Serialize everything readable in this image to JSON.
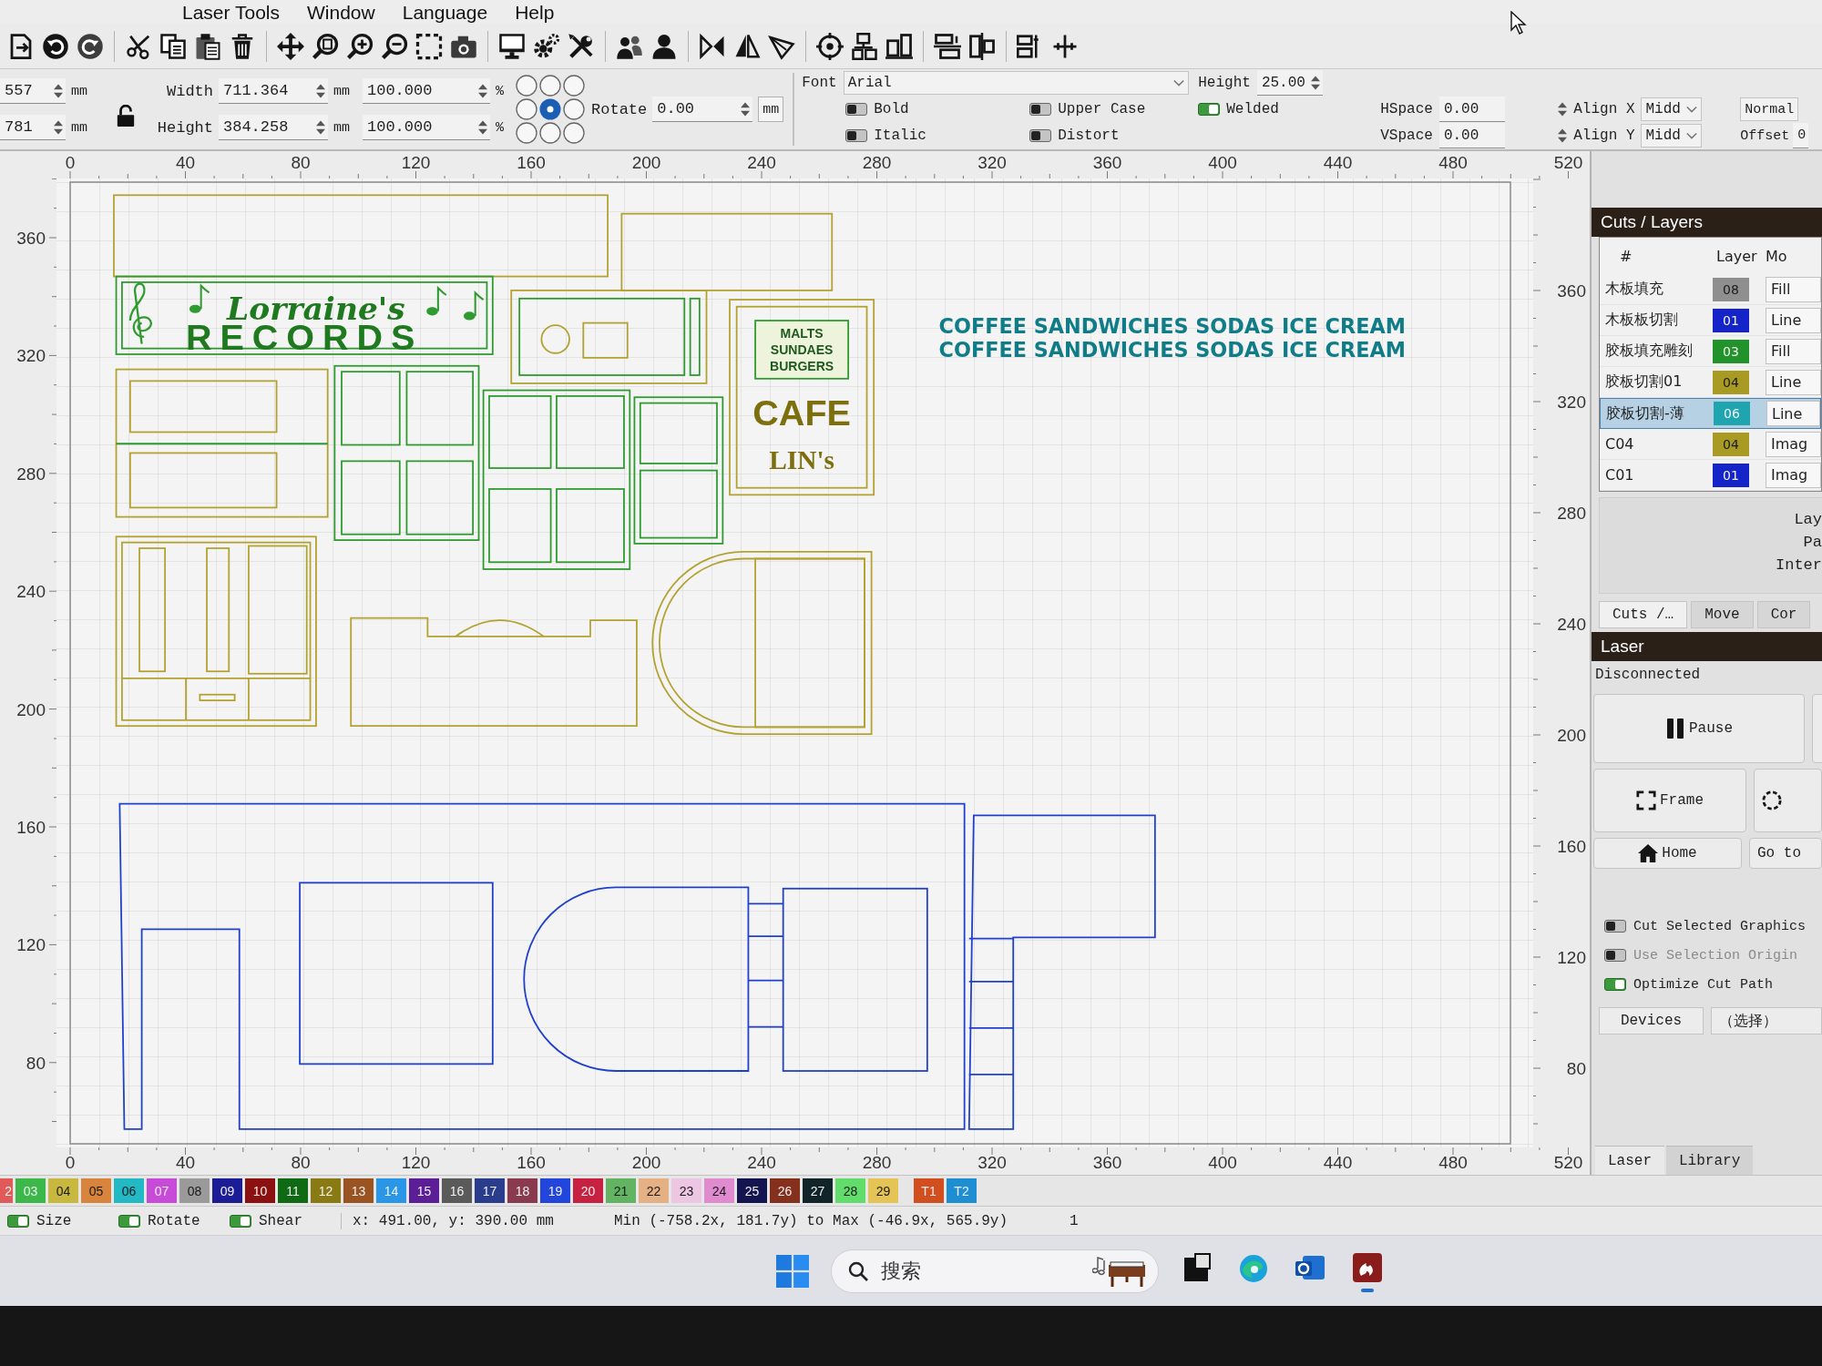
{
  "menu_bar": {
    "items": [
      "Laser Tools",
      "Window",
      "Language",
      "Help"
    ]
  },
  "position": {
    "x": {
      "value": "557",
      "unit": "mm"
    },
    "y": {
      "value": "781",
      "unit": "mm"
    }
  },
  "size_lock": {
    "locked": false
  },
  "size": [
    {
      "label": "Width",
      "value": "711.364",
      "unit": "mm",
      "scale": "100.000",
      "scale_unit": "%"
    },
    {
      "label": "Height",
      "value": "384.258",
      "unit": "mm",
      "scale": "100.000",
      "scale_unit": "%"
    }
  ],
  "origin_points": [
    {
      "selected": false
    },
    {
      "selected": false
    },
    {
      "selected": false
    },
    {
      "selected": false
    },
    {
      "selected": true
    },
    {
      "selected": false
    },
    {
      "selected": false
    },
    {
      "selected": false
    },
    {
      "selected": false
    }
  ],
  "rotate": {
    "label": "Rotate",
    "value": "0.00",
    "unit_button": "mm"
  },
  "text_options": {
    "font": {
      "label": "Font",
      "value": "Arial"
    },
    "toggles": [
      {
        "label": "Bold",
        "on": false
      },
      {
        "label": "Italic",
        "on": false
      },
      {
        "label": "Upper Case",
        "on": false
      },
      {
        "label": "Distort",
        "on": false
      },
      {
        "label": "Welded",
        "on": true
      }
    ],
    "height": {
      "label": "Height",
      "value": "25.00"
    },
    "hspace": {
      "label": "HSpace",
      "value": "0.00"
    },
    "vspace": {
      "label": "VSpace",
      "value": "0.00"
    },
    "align_x": {
      "label": "Align X",
      "value": "Midd"
    },
    "align_y": {
      "label": "Align Y",
      "value": "Midd"
    },
    "style": "Normal",
    "offset": {
      "label": "Offset",
      "value": "0"
    }
  },
  "canvas": {
    "top_ruler": [
      "0",
      "40",
      "80",
      "120",
      "160",
      "200",
      "240",
      "280",
      "320",
      "360",
      "400",
      "440",
      "480",
      "520"
    ],
    "left_ruler": [
      "360",
      "320",
      "280",
      "240",
      "200",
      "160",
      "120",
      "80"
    ],
    "right_ruler": [
      "360",
      "320",
      "280",
      "240",
      "200",
      "160",
      "120",
      "80"
    ],
    "bottom_ruler": [
      "0",
      "40",
      "80",
      "120",
      "160",
      "200",
      "240",
      "280",
      "320",
      "360",
      "400",
      "440",
      "480",
      "520"
    ],
    "texts": [
      {
        "kind": "script",
        "text": "Lorraine's"
      },
      {
        "kind": "outline",
        "text": "RECORDS"
      },
      {
        "kind": "block",
        "text": "MALTS"
      },
      {
        "kind": "block",
        "text": "SUNDAES"
      },
      {
        "kind": "block",
        "text": "BURGERS"
      },
      {
        "kind": "outline",
        "text": "CAFE"
      },
      {
        "kind": "serif",
        "text": "LIN's"
      },
      {
        "kind": "banner",
        "text": "COFFEE SANDWICHES SODAS ICE CREAM"
      },
      {
        "kind": "banner",
        "text": "COFFEE SANDWICHES SODAS ICE CREAM"
      }
    ]
  },
  "cuts_layers": {
    "title": "Cuts / Layers",
    "columns": [
      "#",
      "Layer",
      "Mo"
    ],
    "rows": [
      {
        "name": "木板填充",
        "number": "08",
        "color": "#8f8f8f",
        "mode": "Fill",
        "selected": false
      },
      {
        "name": "木板板切割",
        "number": "01",
        "color": "#1424c8",
        "mode": "Line",
        "selected": false
      },
      {
        "name": "胶板填充雕刻",
        "number": "03",
        "color": "#22922a",
        "mode": "Fill",
        "selected": false
      },
      {
        "name": "胶板切割01",
        "number": "04",
        "color": "#a89a22",
        "mode": "Line",
        "selected": false
      },
      {
        "name": "胶板切割-薄",
        "number": "06",
        "color": "#1ea5b0",
        "mode": "Line",
        "selected": true
      },
      {
        "name": "C04",
        "number": "04",
        "color": "#a89a22",
        "mode": "Imag",
        "selected": false
      },
      {
        "name": "C01",
        "number": "01",
        "color": "#1424c8",
        "mode": "Imag",
        "selected": false
      }
    ],
    "details": [
      "Lay",
      "Pa",
      "Inter"
    ]
  },
  "panel_tabs": [
    {
      "label": "Cuts /…",
      "selected": true
    },
    {
      "label": "Move",
      "selected": false
    },
    {
      "label": "Cor",
      "selected": false
    }
  ],
  "laser": {
    "title": "Laser",
    "status": "Disconnected",
    "buttons": [
      {
        "kind": "pause",
        "label": "Pause"
      },
      {
        "kind": "blank"
      },
      {
        "kind": "frame",
        "label": "Frame"
      },
      {
        "kind": "dashed_circle"
      },
      {
        "kind": "home",
        "label": "Home"
      },
      {
        "kind": "text",
        "label": "Go to"
      }
    ],
    "options": [
      {
        "label": "Cut Selected Graphics",
        "on": false,
        "disabled": false
      },
      {
        "label": "Use Selection Origin",
        "on": false,
        "disabled": true
      },
      {
        "label": "Optimize Cut Path",
        "on": true,
        "disabled": false
      }
    ],
    "devices_button": "Devices",
    "device_select": "（选择）"
  },
  "bottom_tabs": [
    {
      "label": "Laser",
      "selected": true
    },
    {
      "label": "Library",
      "selected": false
    }
  ],
  "palette": [
    {
      "kind": "layer",
      "label": "2",
      "color": "#e05a5a"
    },
    {
      "kind": "layer",
      "label": "03",
      "color": "#3cb84a"
    },
    {
      "kind": "layer",
      "label": "04",
      "color": "#c8b840"
    },
    {
      "kind": "layer",
      "label": "05",
      "color": "#d8843c"
    },
    {
      "kind": "layer",
      "label": "06",
      "color": "#22b8c4"
    },
    {
      "kind": "layer",
      "label": "07",
      "color": "#c84ad8"
    },
    {
      "kind": "layer",
      "label": "08",
      "color": "#9a9a9a"
    },
    {
      "kind": "layer",
      "label": "09",
      "color": "#1c1c96"
    },
    {
      "kind": "layer",
      "label": "10",
      "color": "#8c1010"
    },
    {
      "kind": "layer",
      "label": "11",
      "color": "#106a14"
    },
    {
      "kind": "layer",
      "label": "12",
      "color": "#8a7a14"
    },
    {
      "kind": "layer",
      "label": "13",
      "color": "#9a5422"
    },
    {
      "kind": "layer",
      "label": "14",
      "color": "#2a96e8"
    },
    {
      "kind": "layer",
      "label": "15",
      "color": "#5c1e96"
    },
    {
      "kind": "layer",
      "label": "16",
      "color": "#5a5a5a"
    },
    {
      "kind": "layer",
      "label": "17",
      "color": "#2a3c8c"
    },
    {
      "kind": "layer",
      "label": "18",
      "color": "#8a3a4e"
    },
    {
      "kind": "layer",
      "label": "19",
      "color": "#2246dc"
    },
    {
      "kind": "layer",
      "label": "20",
      "color": "#c82040"
    },
    {
      "kind": "layer",
      "label": "21",
      "color": "#62b462"
    },
    {
      "kind": "layer",
      "label": "22",
      "color": "#e4b084"
    },
    {
      "kind": "layer",
      "label": "23",
      "color": "#ecc6e2"
    },
    {
      "kind": "layer",
      "label": "24",
      "color": "#e08ad0"
    },
    {
      "kind": "layer",
      "label": "25",
      "color": "#141450"
    },
    {
      "kind": "layer",
      "label": "26",
      "color": "#84301c"
    },
    {
      "kind": "layer",
      "label": "27",
      "color": "#10242a"
    },
    {
      "kind": "layer",
      "label": "28",
      "color": "#62dc6a"
    },
    {
      "kind": "layer",
      "label": "29",
      "color": "#e4c454"
    },
    {
      "kind": "tool",
      "label": "T1",
      "color": "#d24e1e"
    },
    {
      "kind": "tool",
      "label": "T2",
      "color": "#1e8ed2"
    }
  ],
  "status_bar": {
    "toggles": [
      {
        "label": "Size",
        "on": true
      },
      {
        "label": "Rotate",
        "on": true
      },
      {
        "label": "Shear",
        "on": true
      }
    ],
    "coords": "x: 491.00, y: 390.00 mm",
    "bounds": "Min (-758.2x, 181.7y) to Max (-46.9x, 565.9y)",
    "count": "1"
  },
  "taskbar": {
    "search": {
      "placeholder": "搜索"
    },
    "apps": [
      {
        "kind": "square",
        "active": false
      },
      {
        "kind": "browser",
        "active": false
      },
      {
        "kind": "mail",
        "active": false
      },
      {
        "kind": "flame",
        "active": true
      }
    ]
  }
}
